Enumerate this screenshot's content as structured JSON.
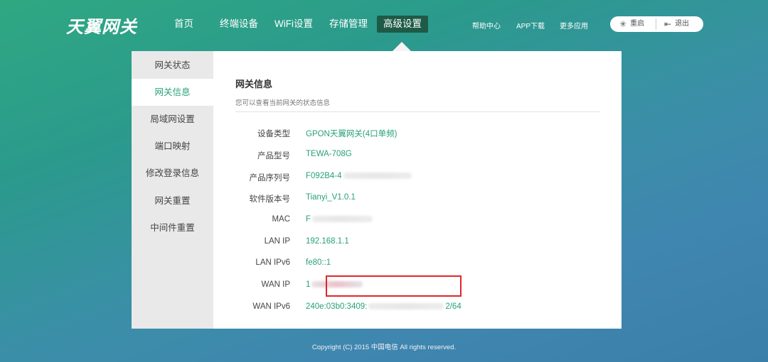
{
  "header": {
    "logo": "天翼网关",
    "nav": [
      {
        "label": "首页"
      },
      {
        "label": "终端设备"
      },
      {
        "label": "WiFi设置"
      },
      {
        "label": "存储管理"
      },
      {
        "label": "高级设置"
      }
    ],
    "links": [
      "帮助中心",
      "APP下载",
      "更多应用"
    ],
    "actions": {
      "restart": "重启",
      "logout": "退出"
    }
  },
  "sidebar": {
    "items": [
      "网关状态",
      "网关信息",
      "局域网设置",
      "端口映射",
      "修改登录信息",
      "网关重置",
      "中间件重置"
    ],
    "active_index": 1
  },
  "content": {
    "title": "网关信息",
    "subtitle": "您可以查看当前网关的状态信息",
    "rows": [
      {
        "label": "设备类型",
        "value": "GPON天翼网关(4口单频)"
      },
      {
        "label": "产品型号",
        "value": "TEWA-708G"
      },
      {
        "label": "产品序列号",
        "value": "F092B4-4"
      },
      {
        "label": "软件版本号",
        "value": "Tianyi_V1.0.1"
      },
      {
        "label": "MAC",
        "value": "F"
      },
      {
        "label": "LAN IP",
        "value": "192.168.1.1"
      },
      {
        "label": "LAN IPv6",
        "value": "fe80::1"
      },
      {
        "label": "WAN IP",
        "value": "1"
      },
      {
        "label": "WAN IPv6",
        "value_start": "240e:03b0:3409:",
        "value_end": "2/64"
      }
    ]
  },
  "footer": {
    "text": "Copyright (C) 2015 中国电信 All rights reserved."
  },
  "colors": {
    "accent": "#27a17a",
    "nav_active": "#1e5a45",
    "highlight": "#e0262b"
  }
}
